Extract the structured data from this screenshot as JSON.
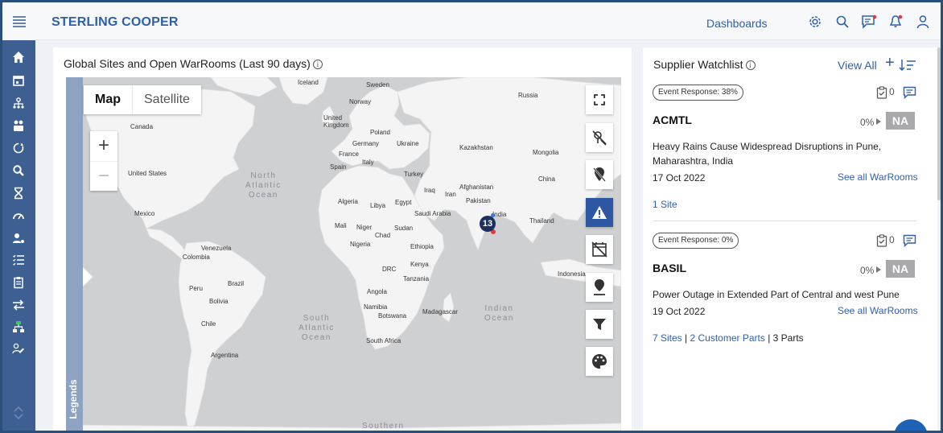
{
  "header": {
    "brand": "STERLING COOPER",
    "dashboards_label": "Dashboards",
    "icons": [
      "menu-icon",
      "settings-icon",
      "search-icon",
      "messages-icon",
      "notifications-icon",
      "user-icon"
    ]
  },
  "sidebar": {
    "items": [
      "home-icon",
      "calendar-icon",
      "network-icon",
      "suppliers-icon",
      "refresh-icon",
      "search-icon",
      "hourglass-icon",
      "gauge-icon",
      "user-settings-icon",
      "list-icon",
      "clipboard-icon",
      "transfers-icon",
      "org-chart-icon",
      "edit-user-icon",
      "collapse-icon"
    ]
  },
  "map_panel": {
    "title": "Global Sites and Open WarRooms (Last 90 days)",
    "map_type_map": "Map",
    "map_type_satellite": "Satellite",
    "zoom_in": "+",
    "zoom_out": "−",
    "legends_label": "Legends",
    "cluster_count": "13",
    "controls": [
      "fullscreen-icon",
      "route-off-icon",
      "location-off-icon",
      "alert-icon",
      "calendar-off-icon",
      "pin-drop-icon",
      "filter-icon",
      "palette-icon"
    ],
    "labels": {
      "iceland": "Iceland",
      "sweden": "Sweden",
      "norway": "Norway",
      "russia": "Russia",
      "uk": "United\nKingdom",
      "poland": "Poland",
      "germany": "Germany",
      "ukraine": "Ukraine",
      "france": "France",
      "spain": "Spain",
      "italy": "Italy",
      "kazakhstan": "Kazakhstan",
      "mongolia": "Mongolia",
      "turkey": "Turkey",
      "china": "China",
      "iraq": "Iraq",
      "iran": "Iran",
      "afghanistan": "Afghanistan",
      "pakistan": "Pakistan",
      "algeria": "Algeria",
      "libya": "Libya",
      "egypt": "Egypt",
      "saudi": "Saudi Arabia",
      "india": "India",
      "thailand": "Thailand",
      "mali": "Mali",
      "niger": "Niger",
      "sudan": "Sudan",
      "chad": "Chad",
      "nigeria": "Nigeria",
      "ethiopia": "Ethiopia",
      "drc": "DRC",
      "kenya": "Kenya",
      "tanzania": "Tanzania",
      "indonesia": "Indonesia",
      "angola": "Angola",
      "namibia": "Namibia",
      "botswana": "Botswana",
      "madagascar": "Madagascar",
      "south_africa": "South Africa",
      "canada": "Canada",
      "usa": "United States",
      "mexico": "Mexico",
      "venezuela": "Venezuela",
      "colombia": "Colombia",
      "peru": "Peru",
      "brazil": "Brazil",
      "bolivia": "Bolivia",
      "chile": "Chile",
      "argentina": "Argentina",
      "north_atlantic": "North\nAtlantic\nOcean",
      "south_atlantic": "South\nAtlantic\nOcean",
      "indian_ocean": "Indian\nOcean",
      "southern": "Southern"
    }
  },
  "watchlist": {
    "title": "Supplier Watchlist",
    "view_all": "View All",
    "add_label": "+",
    "items": [
      {
        "event_response": "Event Response: 38%",
        "task_count": "0",
        "name": "ACMTL",
        "percent": "0%",
        "badge": "NA",
        "event": "Heavy Rains Cause Widespread Disruptions in Pune, Maharashtra, India",
        "date": "17 Oct 2022",
        "see_all": "See all WarRooms",
        "sites": "1 Site"
      },
      {
        "event_response": "Event Response: 0%",
        "task_count": "0",
        "name": "BASIL",
        "percent": "0%",
        "badge": "NA",
        "event": "Power Outage in Extended Part of Central and west Pune",
        "date": "19 Oct 2022",
        "see_all": "See all WarRooms",
        "sites": "7 Sites",
        "sep1": " | ",
        "customer_parts": "2 Customer Parts",
        "sep2": " | ",
        "parts": "3 Parts"
      }
    ]
  },
  "colors": {
    "brand": "#2f5fa8",
    "sidebar": "#3d5f92",
    "active_control": "#2d56a3",
    "land": "#f4f4f4",
    "water": "#cfd0d2"
  }
}
